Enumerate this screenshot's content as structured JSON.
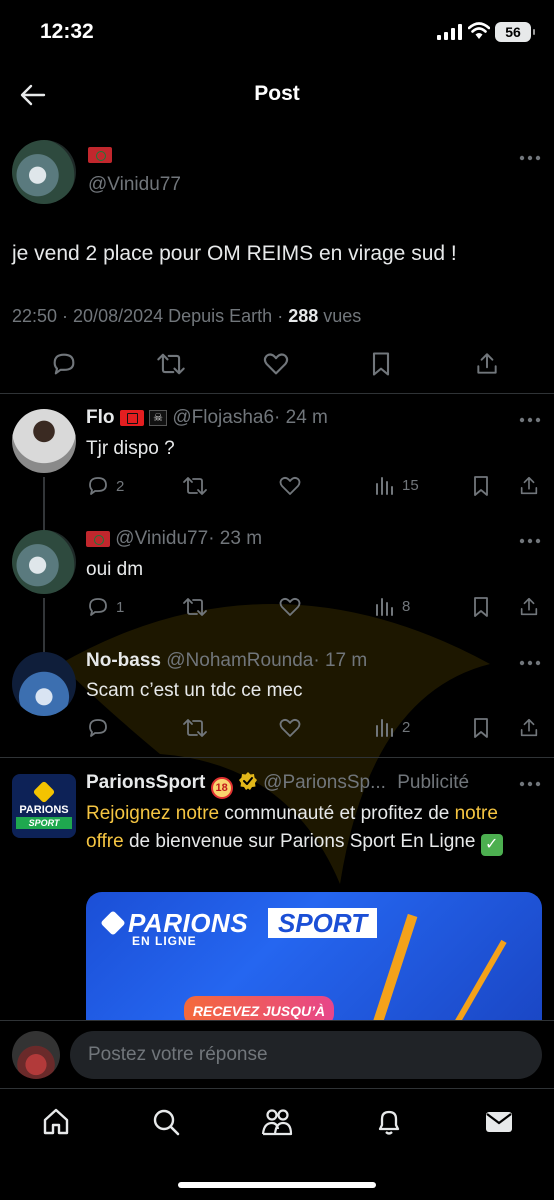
{
  "status_bar": {
    "time": "12:32",
    "battery": "56"
  },
  "header": {
    "title": "Post"
  },
  "post": {
    "handle": "@Vinidu77",
    "text": "je vend 2 place pour OM REIMS en virage sud !",
    "timestamp": "22:50 · 20/08/2024 Depuis Earth",
    "views_count": "288",
    "views_label": " vues"
  },
  "replies": [
    {
      "name": "Flo",
      "handle": "@Flojasha6",
      "time": "· 24 m",
      "text": "Tjr dispo ?",
      "replies": "2",
      "views": "15"
    },
    {
      "name": "",
      "handle": "@Vinidu77",
      "time": "· 23 m",
      "text": "oui dm",
      "replies": "1",
      "views": "8"
    },
    {
      "name": "No-bass",
      "handle": "@NohamRounda",
      "time": "· 17 m",
      "text": "Scam c’est un tdc ce mec",
      "replies": "",
      "views": "2"
    }
  ],
  "ad": {
    "name": "ParionsSport",
    "age_badge": "18",
    "handle": "@ParionsSp...",
    "label": "Publicité",
    "text_hl1": "Rejoignez notre",
    "text_1": " communauté et profitez de ",
    "text_hl2": "notre offre",
    "text_2": " de bienvenue sur Parions Sport En Ligne ",
    "logo_top": "PARIONS",
    "logo_bottom": "SPORT",
    "banner_word1": "PARIONS",
    "banner_word2": "SPORT",
    "banner_sub": "EN LIGNE",
    "banner_pill": "RECEVEZ JUSQU’À"
  },
  "composer": {
    "placeholder": "Postez votre réponse"
  },
  "colors": {
    "accent": "#1d9bf0",
    "muted": "#71767b",
    "link_yellow": "#f5c542"
  }
}
